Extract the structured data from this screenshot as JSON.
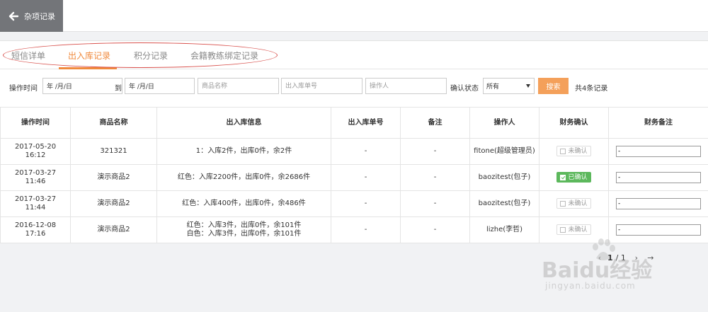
{
  "topbar": {
    "back_label": "杂项记录"
  },
  "tabs": [
    {
      "label": "短信详单",
      "active": false
    },
    {
      "label": "出入库记录",
      "active": true
    },
    {
      "label": "积分记录",
      "active": false
    },
    {
      "label": "会籍教练绑定记录",
      "active": false
    }
  ],
  "filters": {
    "time_label": "操作时间",
    "date_from": "年 /月/日",
    "to_label": "到",
    "date_to": "年 /月/日",
    "product_placeholder": "商品名称",
    "order_placeholder": "出入库单号",
    "operator_placeholder": "操作人",
    "confirm_label": "确认状态",
    "confirm_value": "所有",
    "search_label": "搜索",
    "record_count": "共4条记录"
  },
  "table": {
    "headers": [
      "操作时间",
      "商品名称",
      "出入库信息",
      "出入库单号",
      "备注",
      "操作人",
      "财务确认",
      "财务备注"
    ],
    "rows": [
      {
        "time": "2017-05-20 16:12",
        "product": "321321",
        "info": "1：入库2件，出库0件，余2件",
        "order_no": "-",
        "remark": "-",
        "operator": "fitone(超级管理员)",
        "confirm": "未确认",
        "confirmed": false,
        "finance_remark": "-"
      },
      {
        "time": "2017-03-27 11:46",
        "product": "演示商品2",
        "info": "红色：入库2200件，出库0件，余2686件",
        "order_no": "-",
        "remark": "-",
        "operator": "baozitest(包子)",
        "confirm": "已确认",
        "confirmed": true,
        "finance_remark": "-"
      },
      {
        "time": "2017-03-27 11:44",
        "product": "演示商品2",
        "info": "红色：入库400件，出库0件，余486件",
        "order_no": "-",
        "remark": "-",
        "operator": "baozitest(包子)",
        "confirm": "未确认",
        "confirmed": false,
        "finance_remark": "-"
      },
      {
        "time": "2016-12-08 17:16",
        "product": "演示商品2",
        "info": "红色：入库3件，出库0件，余101件\n白色：入库3件，出库0件，余101件",
        "order_no": "-",
        "remark": "-",
        "operator": "lizhe(李哲)",
        "confirm": "未确认",
        "confirmed": false,
        "finance_remark": "-"
      }
    ]
  },
  "pager": {
    "current": "1",
    "total": "/ 1"
  },
  "watermark": {
    "brand": "Baidu经验",
    "url": "jingyan.baidu.com"
  },
  "colors": {
    "accent": "#f08a3d",
    "search_btn": "#f4a05a",
    "confirmed": "#5cb85c",
    "back_bar": "#737579"
  }
}
